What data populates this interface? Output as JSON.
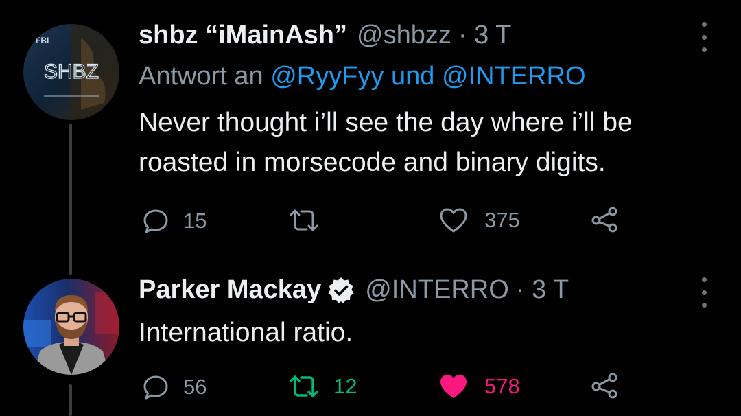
{
  "tweets": [
    {
      "display_name": "shbz “iMainAsh”",
      "handle": "@shbzz",
      "time": "· 3 T",
      "avatar_text": "SHBZ",
      "avatar_badge": "FBI",
      "reply_prefix": "Antwort an",
      "reply_mentions": "@RyyFyy und @INTERRO",
      "text_lines": [
        "Never thought i’ll see the day where i’ll be",
        "roasted in morsecode and binary digits."
      ],
      "replies": "15",
      "retweets": "",
      "likes": "375",
      "retweeted": false,
      "liked": false
    },
    {
      "display_name": "Parker Mackay",
      "handle": "@INTERRO",
      "time": "· 3 T",
      "verified": true,
      "text_lines": [
        "International ratio."
      ],
      "replies": "56",
      "retweets": "12",
      "likes": "578",
      "retweeted": true,
      "liked": true
    }
  ],
  "colors": {
    "background": "#000000",
    "secondary_text": "#8b98a5",
    "mention": "#1d9bf0",
    "retweet_active": "#00ba7c",
    "like_active": "#f91880"
  },
  "icons": [
    "reply-icon",
    "retweet-icon",
    "like-icon",
    "share-icon",
    "more-icon",
    "verified-icon"
  ]
}
